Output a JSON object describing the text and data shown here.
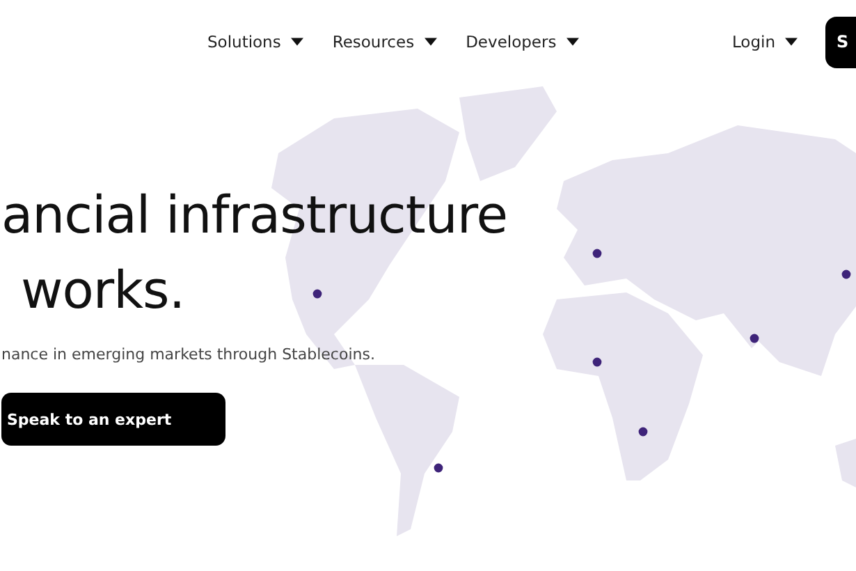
{
  "nav": {
    "items": [
      {
        "label": "Solutions"
      },
      {
        "label": "Resources"
      },
      {
        "label": "Developers"
      }
    ],
    "login": "Login",
    "cta": "S"
  },
  "hero": {
    "headline": [
      "ancial infrastructure",
      "works."
    ],
    "subtitle": "nance in emerging markets through Stablecoins.",
    "button": "Speak to an expert"
  }
}
